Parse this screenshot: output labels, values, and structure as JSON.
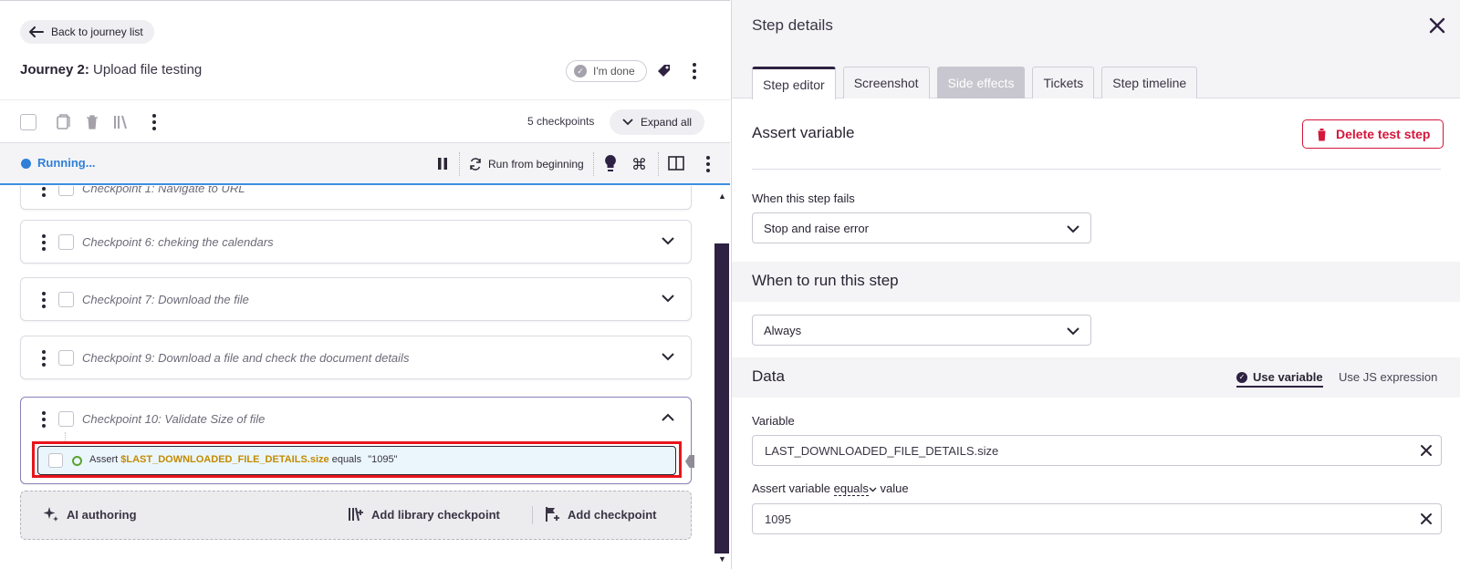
{
  "header": {
    "back_label": "Back to journey list",
    "journey_prefix": "Journey 2:",
    "journey_name": "Upload file testing",
    "done_label": "I'm done"
  },
  "toolbar": {
    "checkpoint_count": "5 checkpoints",
    "expand_label": "Expand all"
  },
  "runbar": {
    "status": "Running...",
    "run_from_beginning": "Run from beginning",
    "status_color": "#2f80d8"
  },
  "checkpoints": [
    {
      "label": "Checkpoint 1:  Navigate to URL"
    },
    {
      "label": "Checkpoint 6:  cheking the calendars"
    },
    {
      "label": "Checkpoint 7:  Download the file"
    },
    {
      "label": "Checkpoint 9:  Download a file and check the document details"
    },
    {
      "label": "Checkpoint 10:  Validate Size of file"
    }
  ],
  "step": {
    "action": "Assert",
    "variable": "$LAST_DOWNLOADED_FILE_DETAILS.size",
    "operator": "equals",
    "value": "\"1095\""
  },
  "add_bar": {
    "ai_authoring": "AI authoring",
    "add_library": "Add library checkpoint",
    "add_checkpoint": "Add checkpoint"
  },
  "details": {
    "title": "Step details",
    "tabs": [
      "Step editor",
      "Screenshot",
      "Side effects",
      "Tickets",
      "Step timeline"
    ],
    "section_title": "Assert variable",
    "delete_label": "Delete test step",
    "fail_label": "When this step fails",
    "fail_value": "Stop and raise error",
    "when_title": "When to run this step",
    "when_value": "Always",
    "data_title": "Data",
    "use_variable": "Use variable",
    "use_js": "Use JS expression",
    "variable_label": "Variable",
    "variable_value": "LAST_DOWNLOADED_FILE_DETAILS.size",
    "assert_prefix": "Assert variable",
    "assert_op": "equals",
    "assert_suffix": "value",
    "assert_value": "1095"
  },
  "colors": {
    "accent": "#2e2142",
    "danger": "#d4163c",
    "highlight": "#e8141b",
    "variable": "#c48a00"
  }
}
